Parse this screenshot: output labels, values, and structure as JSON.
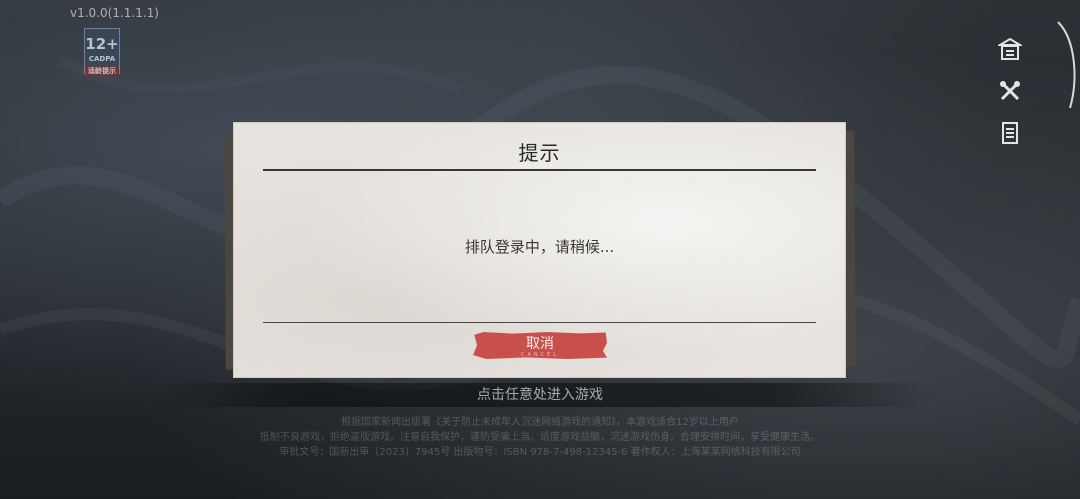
{
  "version": "v1.0.0(1.1.1.1)",
  "age_rating": {
    "age": "12+",
    "sub": "CADPA",
    "note": "适龄提示"
  },
  "side_icons": [
    "notice-icon",
    "tools-icon",
    "document-icon"
  ],
  "dialog": {
    "title": "提示",
    "message": "排队登录中，请稍候...",
    "cancel_label": "取消",
    "cancel_sub": "CANCEL"
  },
  "enter_prompt": "点击任意处进入游戏",
  "legal_lines": [
    "根据国家新闻出版署《关于防止未成年人沉迷网络游戏的通知》，本游戏适合12岁以上用户",
    "抵制不良游戏，拒绝盗版游戏。注意自我保护，谨防受骗上当。适度游戏益脑，沉迷游戏伤身。合理安排时间，享受健康生活。",
    "审批文号：国新出审〔2023〕7945号 出版物号：ISBN 978-7-498-12345-6 著作权人：上海某某网络科技有限公司"
  ],
  "colors": {
    "dialog_bg": "#e6e3de",
    "cancel_button": "#c8504a",
    "text_dark": "#2b2926"
  }
}
